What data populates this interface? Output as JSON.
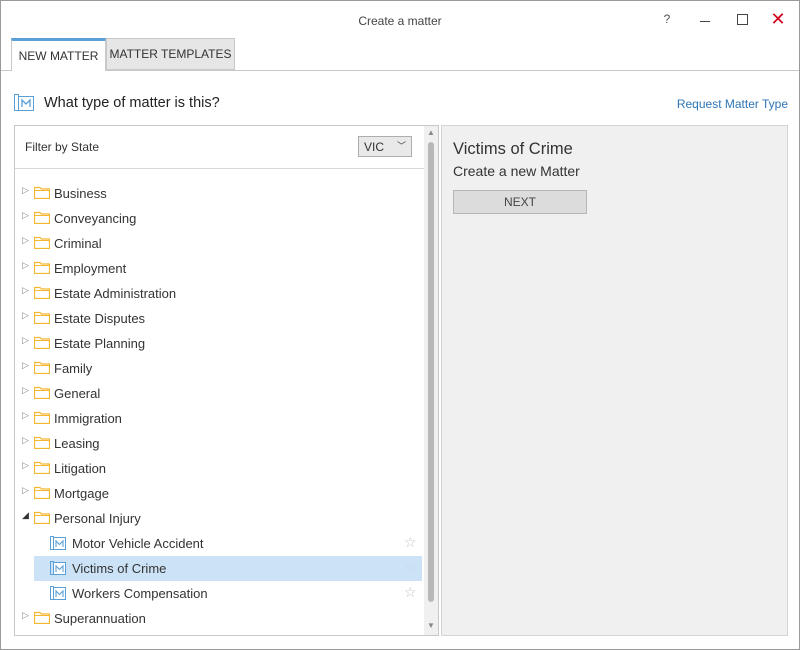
{
  "window": {
    "title": "Create a matter",
    "help": "?"
  },
  "tabs": [
    {
      "label": "NEW MATTER"
    },
    {
      "label": "MATTER TEMPLATES"
    }
  ],
  "header": {
    "question": "What type of matter is this?",
    "request_link": "Request Matter Type"
  },
  "filter": {
    "label": "Filter by State",
    "state_value": "VIC"
  },
  "tree": {
    "categories_before": [
      "Business",
      "Conveyancing",
      "Criminal",
      "Employment",
      "Estate Administration",
      "Estate Disputes",
      "Estate Planning",
      "Family",
      "General",
      "Immigration",
      "Leasing",
      "Litigation",
      "Mortgage"
    ],
    "expanded_category": "Personal Injury",
    "children": [
      "Motor Vehicle Accident",
      "Victims of Crime",
      "Workers Compensation"
    ],
    "selected_child": "Victims of Crime",
    "categories_after": [
      "Superannuation"
    ]
  },
  "detail": {
    "title": "Victims of Crime",
    "subtitle": "Create a new Matter",
    "next_label": "NEXT"
  },
  "colors": {
    "accent": "#5aa0d8",
    "link": "#2e75b6",
    "close": "#d0021b",
    "folder": "#f3b730",
    "selection": "#cce3f7"
  }
}
